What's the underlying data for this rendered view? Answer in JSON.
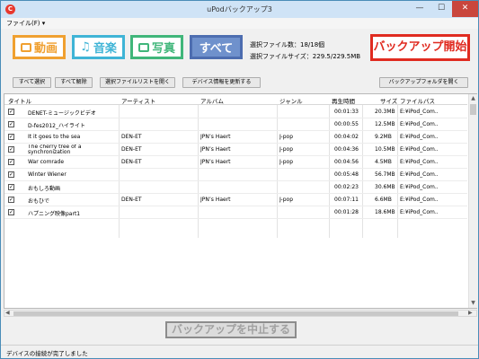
{
  "window": {
    "title": "uPodバックアップ3",
    "icon_letter": "C",
    "min": "—",
    "max": "☐",
    "close": "✕"
  },
  "menu": {
    "file": "ファイル(F) ▾"
  },
  "categories": {
    "video": "動画",
    "music": "音楽",
    "photo": "写真",
    "all": "すべて"
  },
  "selection": {
    "count": "選択ファイル数：18/18個",
    "size": "選択ファイルサイズ：229.5/229.5MB"
  },
  "backup_start": "バックアップ開始",
  "toolbar": {
    "select_all": "すべて選択",
    "deselect_all": "すべて解除",
    "open_list": "選択ファイルリストを開く",
    "refresh_device": "デバイス情報を更新する",
    "open_folder": "バックアップフォルダを開く"
  },
  "table": {
    "headers": [
      "タイトル",
      "アーティスト",
      "アルバム",
      "ジャンル",
      "再生時間",
      "サイズ",
      "ファイルパス"
    ],
    "rows": [
      [
        "DENET-ミュージックビデオ",
        "",
        "",
        "",
        "00:01:33",
        "20.3MB",
        "E:¥iPod_Com.."
      ],
      [
        "D-fes2012_ハイライト",
        "",
        "",
        "",
        "00:00:55",
        "12.5MB",
        "E:¥iPod_Com.."
      ],
      [
        "It it goes to the sea",
        "DEN-ET",
        "JPN’s Haert",
        "J-pop",
        "00:04:02",
        "9.2MB",
        "E:¥iPod_Com.."
      ],
      [
        "The cherry tree of a synchronization",
        "DEN-ET",
        "JPN’s Haert",
        "J-pop",
        "00:04:36",
        "10.5MB",
        "E:¥iPod_Com.."
      ],
      [
        "War comrade",
        "DEN-ET",
        "JPN’s Haert",
        "J-pop",
        "00:04:56",
        "4.5MB",
        "E:¥iPod_Com.."
      ],
      [
        "Winter Wiener",
        "",
        "",
        "",
        "00:05:48",
        "56.7MB",
        "E:¥iPod_Com.."
      ],
      [
        "おもしろ動画",
        "",
        "",
        "",
        "00:02:23",
        "30.6MB",
        "E:¥iPod_Com.."
      ],
      [
        "おもひで",
        "DEN-ET",
        "JPN’s Haert",
        "J-pop",
        "00:07:11",
        "6.6MB",
        "E:¥iPod_Com.."
      ],
      [
        "ハプニング映像part1",
        "",
        "",
        "",
        "00:01:28",
        "18.6MB",
        "E:¥iPod_Com.."
      ]
    ]
  },
  "stop_backup": "バックアップを中止する",
  "status": "デバイスの接続が完了しました"
}
